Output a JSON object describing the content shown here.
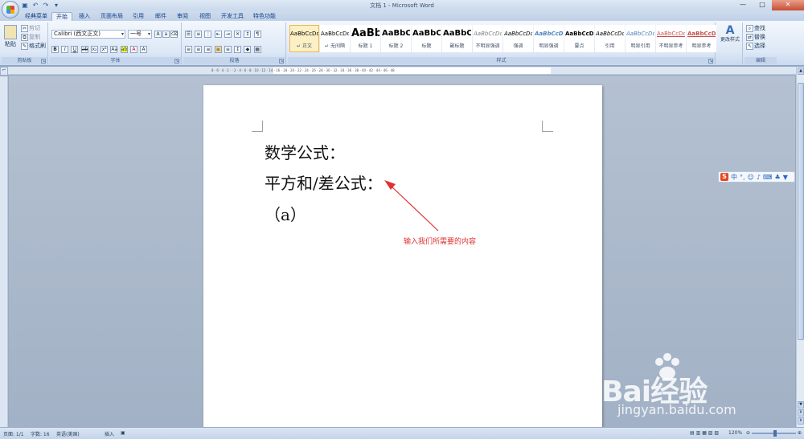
{
  "window": {
    "title": "文档 1 - Microsoft Word",
    "controls": [
      "—",
      "□",
      "✕"
    ]
  },
  "quick_access": [
    "save-icon",
    "undo-icon",
    "redo-icon",
    "customize-icon"
  ],
  "tabs": [
    {
      "label": "经典菜单",
      "active": false
    },
    {
      "label": "开始",
      "active": true
    },
    {
      "label": "插入",
      "active": false
    },
    {
      "label": "页面布局",
      "active": false
    },
    {
      "label": "引用",
      "active": false
    },
    {
      "label": "邮件",
      "active": false
    },
    {
      "label": "审阅",
      "active": false
    },
    {
      "label": "视图",
      "active": false
    },
    {
      "label": "开发工具",
      "active": false
    },
    {
      "label": "特色功能",
      "active": false
    }
  ],
  "ribbon": {
    "clipboard": {
      "label": "剪贴板",
      "paste": "粘贴",
      "cut": "剪切",
      "copy": "复制",
      "format_painter": "格式刷"
    },
    "font": {
      "label": "字体",
      "font_name": "Calibri (西文正文)",
      "font_size": "一号"
    },
    "paragraph": {
      "label": "段落"
    },
    "styles": {
      "label": "样式",
      "items": [
        {
          "sample": "AaBbCcDd",
          "name": "↵ 正文"
        },
        {
          "sample": "AaBbCcDd",
          "name": "↵ 无间隔"
        },
        {
          "sample": "AaBb",
          "name": "标题 1"
        },
        {
          "sample": "AaBbC",
          "name": "标题 2"
        },
        {
          "sample": "AaBbC",
          "name": "标题"
        },
        {
          "sample": "AaBbC",
          "name": "副标题"
        },
        {
          "sample": "AaBbCcDd",
          "name": "不明显强调"
        },
        {
          "sample": "AaBbCcDd",
          "name": "强调"
        },
        {
          "sample": "AaBbCcDd",
          "name": "明显强调"
        },
        {
          "sample": "AaBbCcDd",
          "name": "要点"
        },
        {
          "sample": "AaBbCcDd",
          "name": "引用"
        },
        {
          "sample": "AaBbCcDd",
          "name": "明显引用"
        },
        {
          "sample": "AaBbCcDd",
          "name": "不明显参考"
        },
        {
          "sample": "AaBbCcDd",
          "name": "明显参考"
        }
      ],
      "change_styles": "更改样式"
    },
    "editing": {
      "label": "编辑",
      "find": "查找",
      "replace": "替换",
      "select": "选择"
    }
  },
  "ruler": {
    "marks": "8 · 6 · 4 · 2 · · 2 · 4 · 6 · 8 · 10 · 12 · 14 · 16 · 18 · 20 · 22 · 24 · 26 · 28 · 30 · 32 · 34 · 36 · 38 · 40 · 42 · 44 · 46 · 48"
  },
  "document": {
    "lines": [
      "数学公式：",
      "平方和/差公式：",
      "（a）"
    ]
  },
  "annotation": {
    "text": "输入我们所需要的内容",
    "color": "#e03030"
  },
  "ime": {
    "logo": "S",
    "mode": "中"
  },
  "watermark": {
    "brand": "Bai经验",
    "url": "jingyan.baidu.com"
  },
  "status": {
    "page": "页面: 1/1",
    "words": "字数: 16",
    "language": "英语(美国)",
    "mode": "插入",
    "zoom": "120%"
  },
  "colors": {
    "accent": "#15428b",
    "annotation_red": "#e03030"
  }
}
